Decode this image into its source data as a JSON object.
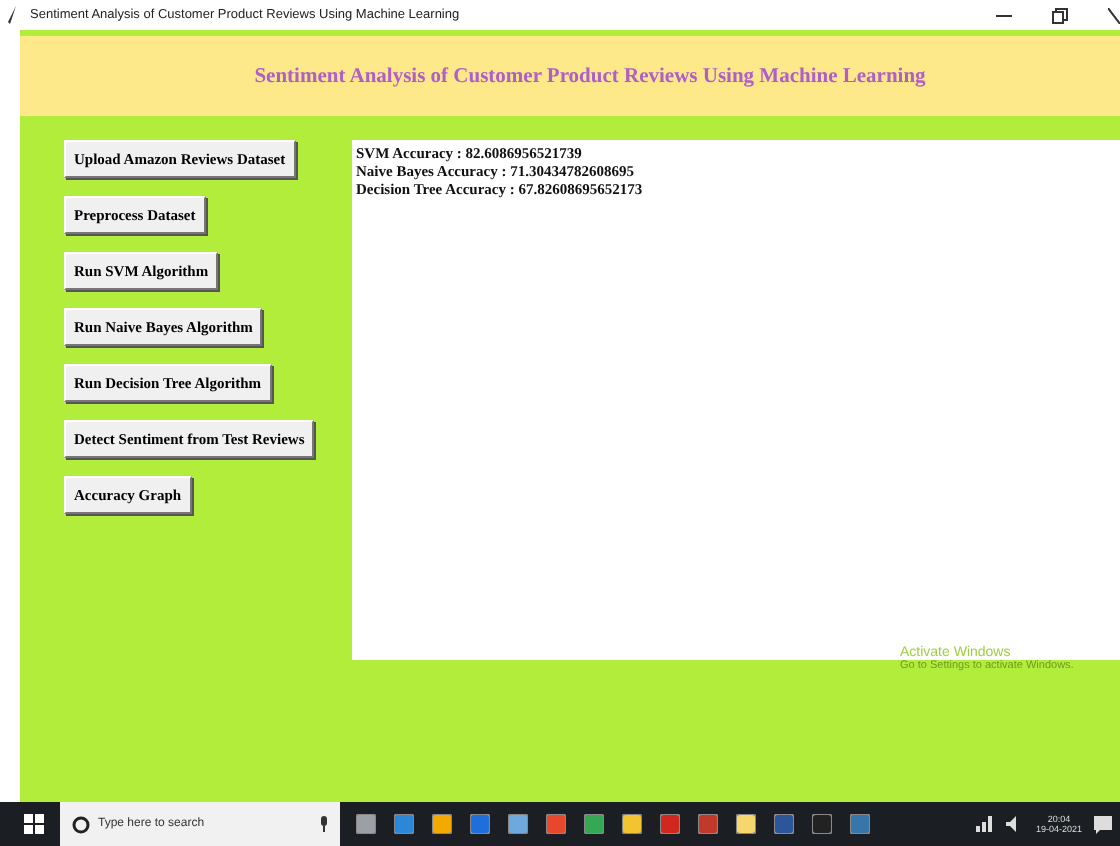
{
  "window": {
    "title": "Sentiment Analysis of Customer Product Reviews Using Machine Learning"
  },
  "header": {
    "title": "Sentiment Analysis of Customer Product Reviews Using Machine Learning"
  },
  "buttons": [
    "Upload Amazon Reviews Dataset",
    "Preprocess Dataset",
    "Run SVM Algorithm",
    "Run Naive Bayes Algorithm",
    "Run Decision Tree Algorithm",
    "Detect Sentiment from Test Reviews",
    "Accuracy Graph"
  ],
  "output": {
    "lines": [
      "SVM Accuracy : 82.6086956521739",
      "Naive Bayes Accuracy : 71.30434782608695",
      "Decision Tree Accuracy : 67.82608695652173"
    ]
  },
  "activation_notice": {
    "title": "Activate Windows",
    "subtitle": "Go to Settings to activate Windows."
  },
  "taskbar": {
    "search_placeholder": "Type here to search",
    "time": "20:04",
    "date": "19-04-2021",
    "apps": [
      {
        "color": "#9aa0a6"
      },
      {
        "color": "#2b88d8"
      },
      {
        "color": "#f2a900"
      },
      {
        "color": "#1e6fd9"
      },
      {
        "color": "#6fa8dc"
      },
      {
        "color": "#e8472c"
      },
      {
        "color": "#34a853"
      },
      {
        "color": "#f4c430"
      },
      {
        "color": "#d0281e"
      },
      {
        "color": "#c0392b"
      },
      {
        "color": "#f5d76e"
      },
      {
        "color": "#2b579a"
      },
      {
        "color": "#222222"
      },
      {
        "color": "#3776ab"
      }
    ]
  }
}
